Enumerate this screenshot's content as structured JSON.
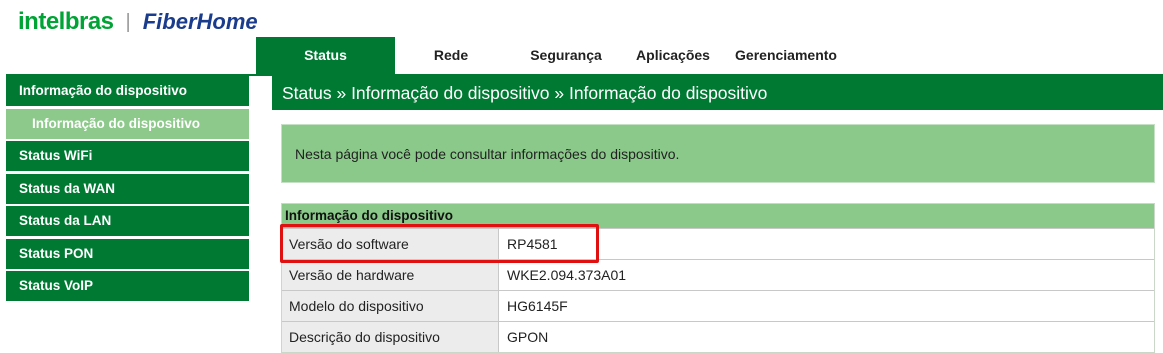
{
  "brand": {
    "logo_left": "intelbras",
    "separator": "|",
    "logo_right": "FiberHome"
  },
  "topnav": {
    "tabs": [
      {
        "label": "Status",
        "active": true
      },
      {
        "label": "Rede",
        "active": false
      },
      {
        "label": "Segurança",
        "active": false
      },
      {
        "label": "Aplicações",
        "active": false
      },
      {
        "label": "Gerenciamento",
        "active": false
      }
    ]
  },
  "sidebar": {
    "items": [
      {
        "label": "Informação do dispositivo"
      },
      {
        "label": "Informação do dispositivo",
        "sub": true,
        "selected": true
      },
      {
        "label": "Status WiFi"
      },
      {
        "label": "Status da WAN"
      },
      {
        "label": "Status da LAN"
      },
      {
        "label": "Status PON"
      },
      {
        "label": "Status VoIP"
      }
    ]
  },
  "breadcrumb": "Status » Informação do dispositivo » Informação do dispositivo",
  "info_text": "Nesta página você pode consultar informações do dispositivo.",
  "device_table": {
    "title": "Informação do dispositivo",
    "rows": [
      {
        "label": "Versão do software",
        "value": "RP4581"
      },
      {
        "label": "Versão de hardware",
        "value": "WKE2.094.373A01"
      },
      {
        "label": "Modelo do dispositivo",
        "value": "HG6145F"
      },
      {
        "label": "Descrição do dispositivo",
        "value": "GPON"
      }
    ]
  },
  "colors": {
    "brand_green": "#007a33",
    "light_green": "#8bc98a",
    "highlight_red": "#e01010",
    "fiberhome_blue": "#1a3c8c"
  }
}
